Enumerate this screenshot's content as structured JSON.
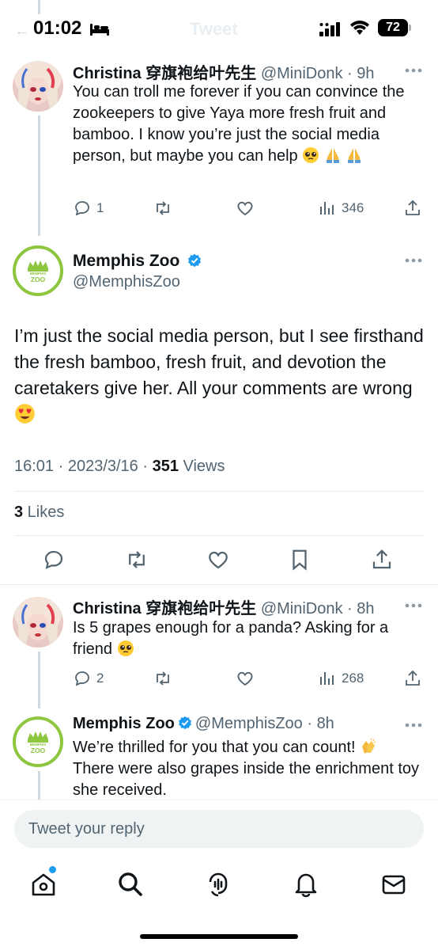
{
  "status_bar": {
    "time": "01:02",
    "battery": "72",
    "faded_back": "←",
    "faded_title": "Tweet"
  },
  "reply_1": {
    "name": "Christina 穿旗袍给叶先生",
    "handle_time": "@MiniDonk · 9h",
    "text": "You can troll me forever if you can convince the zookeepers to give Yaya more fresh fruit and bamboo. I know you’re just the social media person, but maybe you can help",
    "replies": "1",
    "retweets": "",
    "views": "346"
  },
  "main_tweet": {
    "name": "Memphis Zoo",
    "handle": "@MemphisZoo",
    "text": "I’m just the social media person, but I see firsthand the fresh bamboo, fresh fruit, and devotion the caretakers give her. All your comments are wrong",
    "time_date": "16:01 · 2023/3/16 · ",
    "views_count": "351",
    "views_label": " Views",
    "likes_count": "3",
    "likes_label": " Likes",
    "avatar_text_top": "MEMPHIS",
    "avatar_text_bottom": "ZOO"
  },
  "reply_2": {
    "name": "Christina 穿旗袍给叶先生",
    "handle_time": "@MiniDonk · 8h",
    "text": "Is 5 grapes enough for a panda? Asking for a friend",
    "replies": "2",
    "views": "268"
  },
  "reply_3": {
    "name": "Memphis Zoo",
    "handle_time": "@MemphisZoo · 8h",
    "text_1": "We’re thrilled for you that you can count!",
    "text_2": "There were also grapes inside the enrichment toy she received."
  },
  "composer": {
    "placeholder": "Tweet your reply"
  },
  "tabs": [
    {
      "icon": "home-icon"
    },
    {
      "icon": "search-icon"
    },
    {
      "icon": "spaces-icon"
    },
    {
      "icon": "notifications-icon"
    },
    {
      "icon": "messages-icon"
    }
  ],
  "colors": {
    "accent": "#1d9bf0",
    "zoo_green": "#8dc63f",
    "secondary_text": "#536471"
  }
}
